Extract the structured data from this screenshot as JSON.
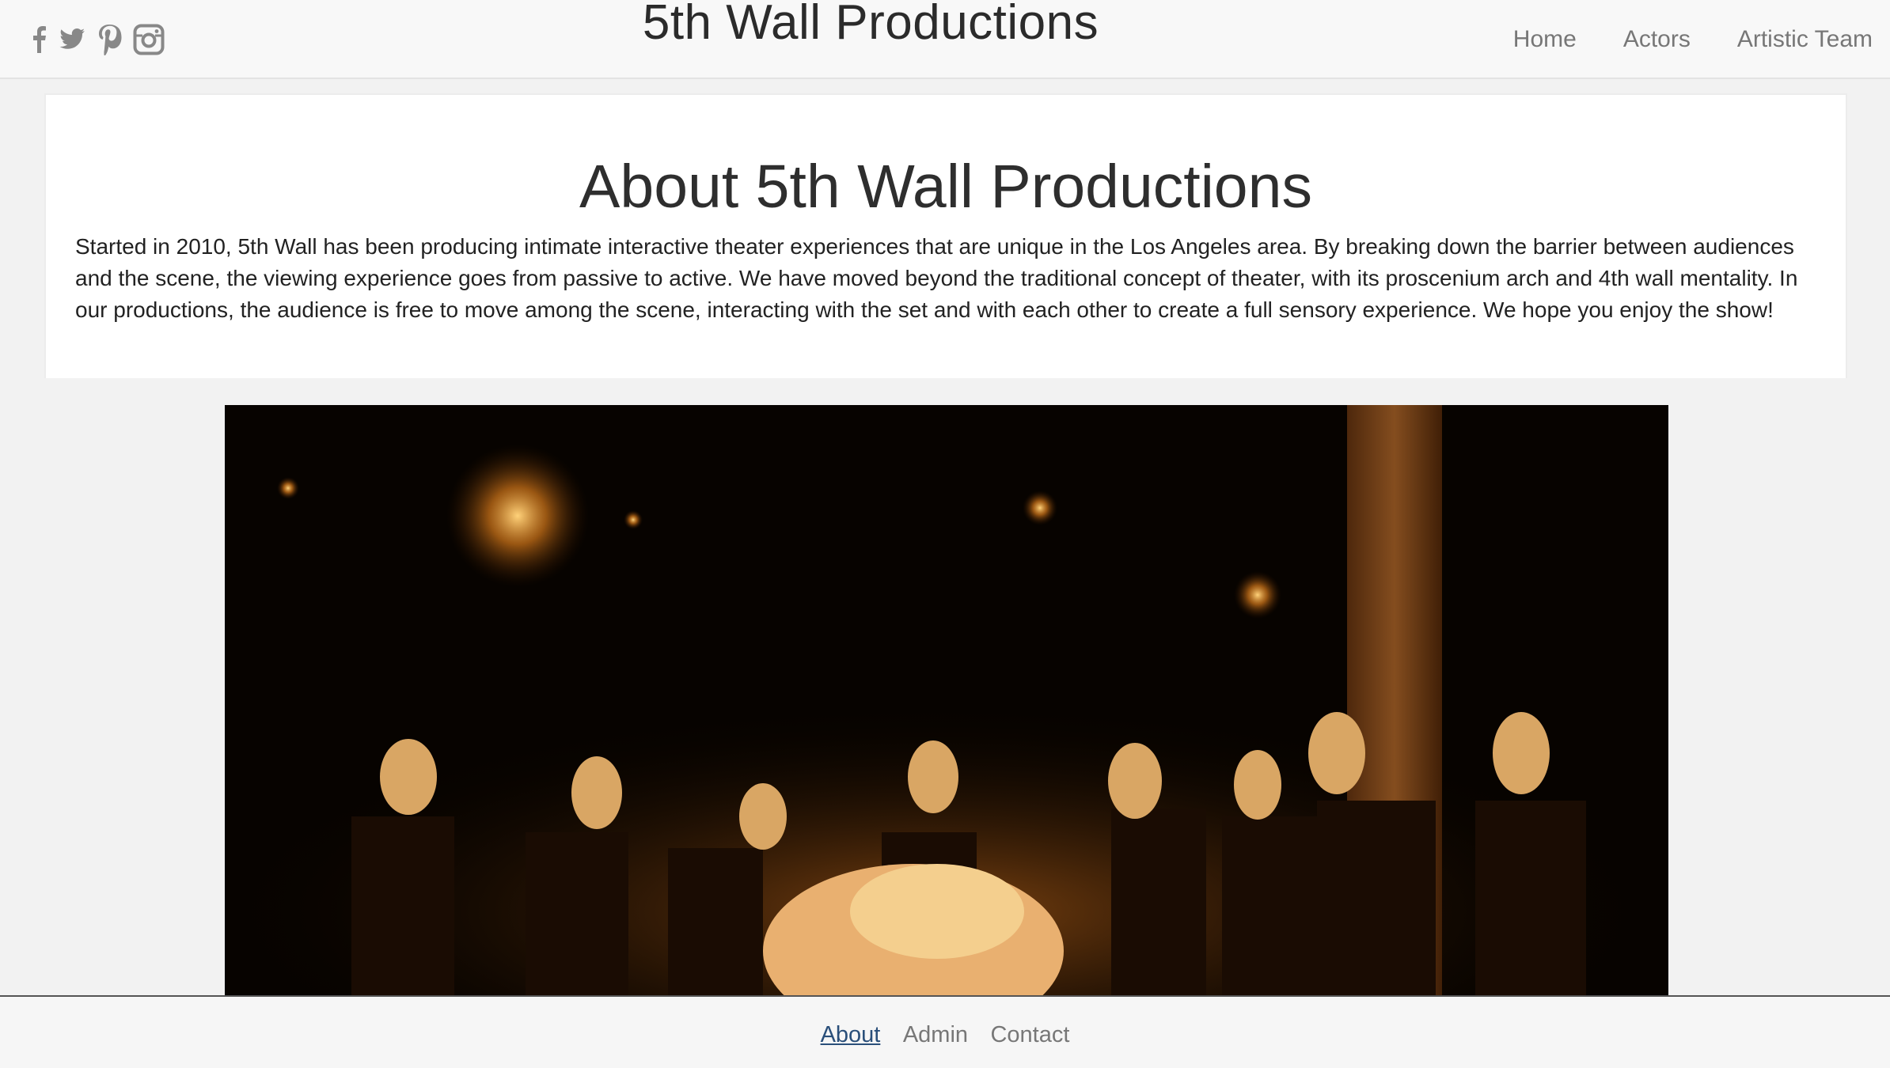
{
  "header": {
    "brand": "5th Wall Productions",
    "social": [
      "facebook-icon",
      "twitter-icon",
      "pinterest-icon",
      "instagram-icon"
    ],
    "nav": [
      {
        "label": "Home"
      },
      {
        "label": "Actors"
      },
      {
        "label": "Artistic Team"
      }
    ]
  },
  "about": {
    "title": "About 5th Wall Productions",
    "body": "Started in 2010, 5th Wall has been producing intimate interactive theater experiences that are unique in the Los Angeles area. By breaking down the barrier between audiences and the scene, the viewing experience goes from passive to active. We have moved beyond the traditional concept of theater, with its proscenium arch and 4th wall mentality. In our productions, the audience is free to move among the scene, interacting with the set and with each other to create a full sensory experience. We hope you enjoy the show!"
  },
  "footer": {
    "links": [
      {
        "label": "About",
        "active": true
      },
      {
        "label": "Admin"
      },
      {
        "label": "Contact"
      }
    ]
  },
  "colors": {
    "link_active": "#2a4f7a",
    "nav_text": "#777777",
    "navbar_bg": "#f8f8f8"
  }
}
